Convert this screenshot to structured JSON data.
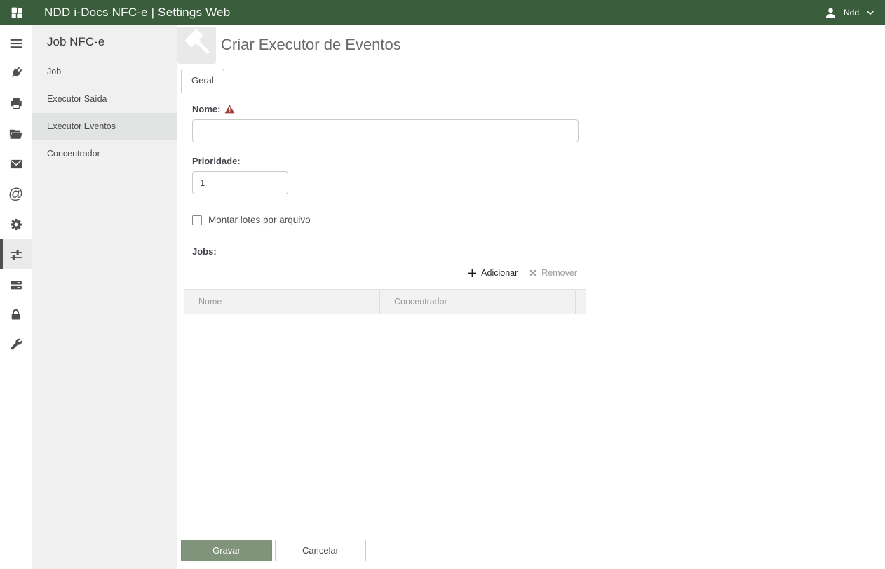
{
  "topbar": {
    "title": "NDD i-Docs NFC-e | Settings Web",
    "user_label": "Ndd"
  },
  "rail": {
    "icons": [
      "menu",
      "plug",
      "printer",
      "folder-open",
      "envelope",
      "at-sign",
      "gear",
      "sliders",
      "server",
      "lock",
      "wrench"
    ],
    "selected_icon": "sliders"
  },
  "sidebar": {
    "title": "Job NFC-e",
    "items": [
      {
        "label": "Job",
        "selected": false
      },
      {
        "label": "Executor Saída",
        "selected": false
      },
      {
        "label": "Executor Eventos",
        "selected": true
      },
      {
        "label": "Concentrador",
        "selected": false
      }
    ]
  },
  "main": {
    "title": "Criar Executor de Eventos",
    "tabs": [
      {
        "label": "Geral",
        "active": true
      }
    ],
    "form": {
      "nome_label": "Nome:",
      "nome_value": "",
      "nome_required": true,
      "prioridade_label": "Prioridade:",
      "prioridade_value": "1",
      "checkbox_label": "Montar lotes por arquivo",
      "checkbox_checked": false,
      "jobs_label": "Jobs:",
      "toolbar": {
        "add_label": "Adicionar",
        "remove_label": "Remover"
      },
      "table": {
        "columns": [
          "Nome",
          "Concentrador"
        ],
        "rows": []
      }
    },
    "actions": {
      "save_label": "Gravar",
      "cancel_label": "Cancelar"
    }
  },
  "colors": {
    "topbar_green": "#3A5E3C",
    "save_green": "#7F947A",
    "warning_red": "#A33E3C",
    "sidebar_gray": "#F0F0F0"
  }
}
